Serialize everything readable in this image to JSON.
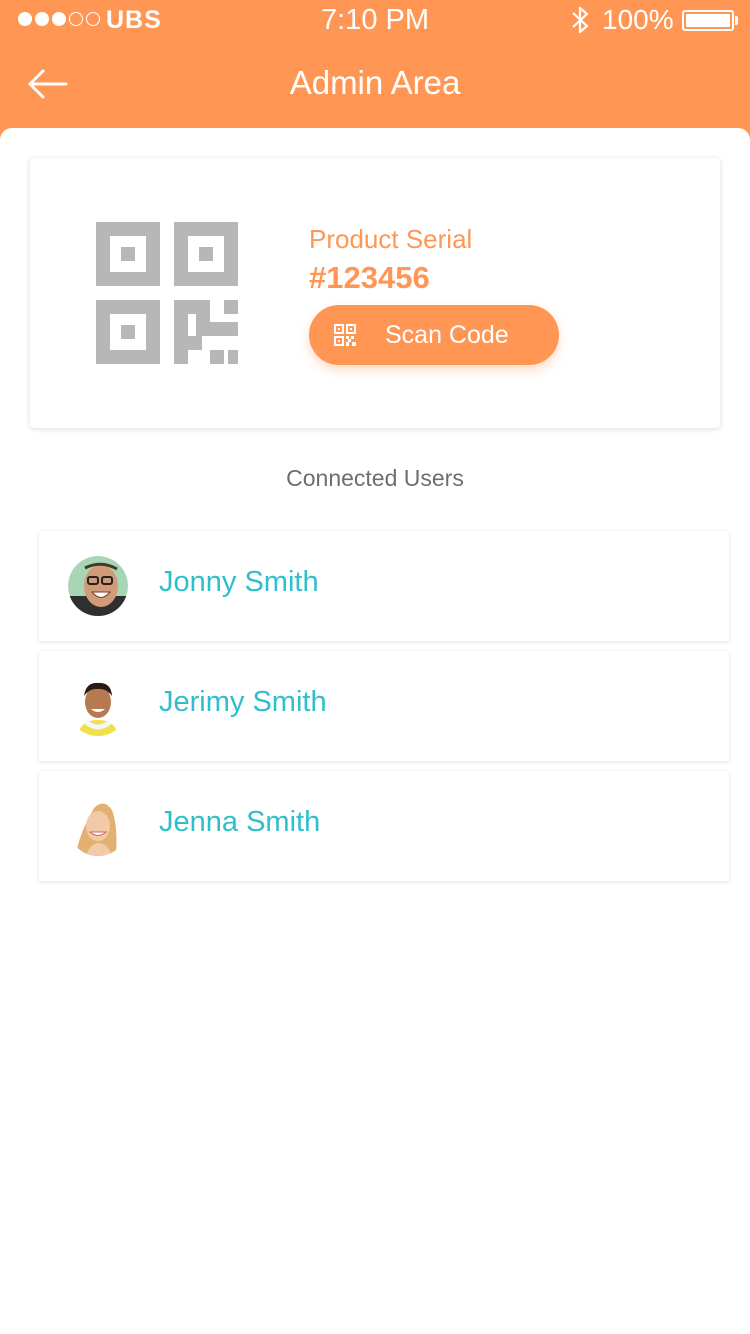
{
  "status_bar": {
    "carrier": "UBS",
    "signal_bars_filled": 3,
    "signal_bars_total": 5,
    "time": "7:10 PM",
    "battery_percent": "100%"
  },
  "header": {
    "title": "Admin Area",
    "back_icon": "arrow-left-icon"
  },
  "product": {
    "qr_icon": "qr-code-icon",
    "serial_label": "Product Serial",
    "serial_value": "#123456",
    "scan_button_label": "Scan Code",
    "scan_icon": "qr-code-icon"
  },
  "connected_users": {
    "title": "Connected Users",
    "users": [
      {
        "name": "Jonny Smith"
      },
      {
        "name": "Jerimy Smith"
      },
      {
        "name": "Jenna Smith"
      }
    ]
  },
  "colors": {
    "accent": "#ff9654",
    "user_name": "#2fbfcb",
    "qr_gray": "#b7b7b7"
  }
}
